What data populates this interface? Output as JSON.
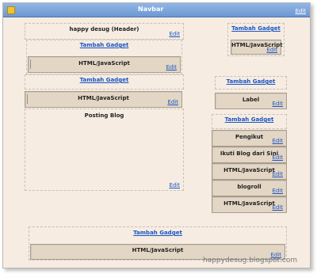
{
  "navbar": {
    "title": "Navbar",
    "edit": "Edit"
  },
  "left": {
    "header": {
      "title": "happy desug (Header)",
      "edit": "Edit"
    },
    "add1": "Tambah Gadget",
    "gadget1": {
      "title": "HTML/JavaScript",
      "edit": "Edit"
    },
    "add2": "Tambah Gadget",
    "gadget2": {
      "title": "HTML/JavaScript",
      "edit": "Edit"
    },
    "posting": {
      "title": "Posting Blog",
      "edit": "Edit"
    }
  },
  "right": {
    "add1": "Tambah Gadget",
    "gadget1": {
      "title": "HTML/JavaScript",
      "edit": "Edit"
    },
    "add2": "Tambah Gadget",
    "label": {
      "title": "Label",
      "edit": "Edit"
    },
    "add3": "Tambah Gadget",
    "pengikut": {
      "title": "Pengikut",
      "edit": "Edit"
    },
    "ikuti": {
      "title": "Ikuti Blog dari Sini",
      "edit": "Edit"
    },
    "gadget2": {
      "title": "HTML/JavaScript",
      "edit": "Edit"
    },
    "blogroll": {
      "title": "blogroll",
      "edit": "Edit"
    },
    "gadget3": {
      "title": "HTML/JavaScript",
      "edit": "Edit"
    }
  },
  "footer": {
    "add": "Tambah Gadget",
    "gadget": {
      "title": "HTML/JavaScript",
      "edit": "Edit"
    }
  },
  "watermark": "happydesug.blogspot.com"
}
